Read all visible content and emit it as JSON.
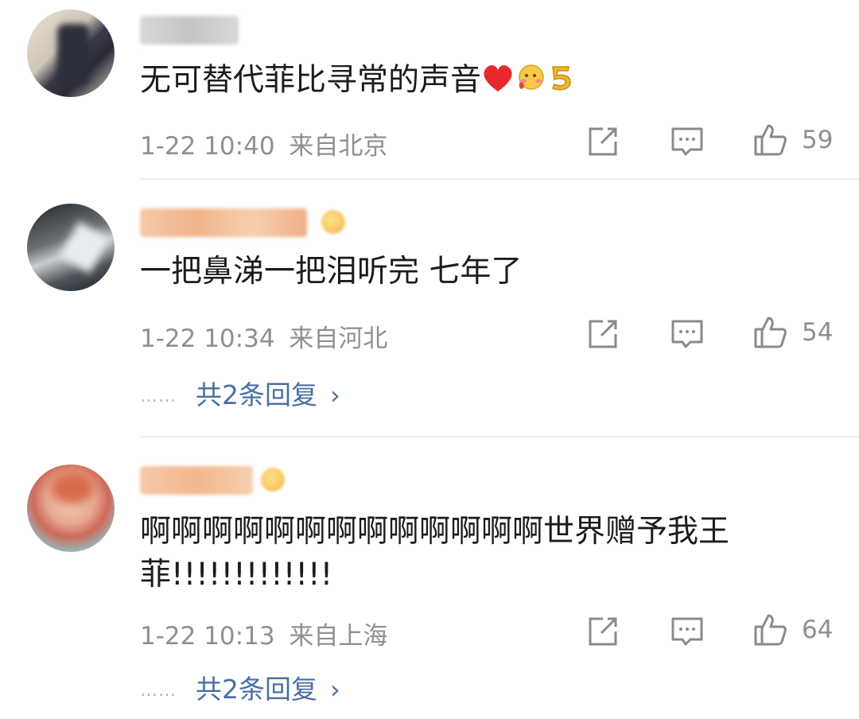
{
  "comments": [
    {
      "text": "无可替代菲比寻常的声音",
      "emojis": [
        "heart-emoji",
        "blush-emoji",
        "five-emoji"
      ],
      "time": "1-22 10:40",
      "location": "来自北京",
      "likes": "59"
    },
    {
      "text": "一把鼻涕一把泪听完 七年了",
      "time": "1-22 10:34",
      "location": "来自河北",
      "likes": "54",
      "replies": "共2条回复"
    },
    {
      "text_line1": "啊啊啊啊啊啊啊啊啊啊啊啊啊世界赠予我王",
      "text_line2": "菲!!!!!!!!!!!!!",
      "time": "1-22 10:13",
      "location": "来自上海",
      "likes": "64",
      "replies": "共2条回复"
    }
  ],
  "reply_dots": "……",
  "icons": {
    "share": "share-icon",
    "comment": "comment-icon",
    "like": "like-icon"
  },
  "colors": {
    "meta": "#8f8f8f",
    "reply_link": "#4a6fa5",
    "heart": "#e8282b"
  }
}
